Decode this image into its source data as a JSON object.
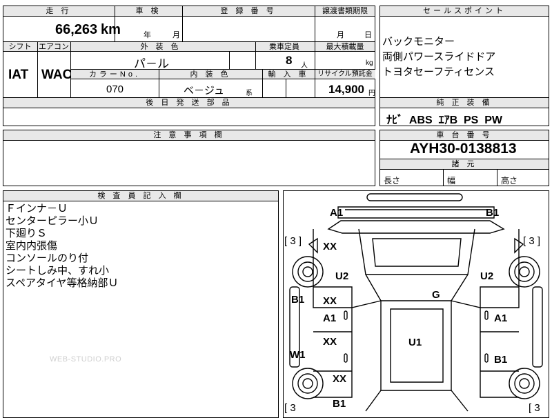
{
  "vehicle": {
    "mileage_label": "走 行",
    "mileage_value": "66,263",
    "mileage_unit": "km",
    "inspection_label": "車 検",
    "inspection_year": "年",
    "inspection_month": "月",
    "registration_label": "登 録 番 号",
    "transfer_label": "譲渡書類期限",
    "transfer_month": "月",
    "transfer_day": "日",
    "shift_label": "シフト",
    "shift_value": "IAT",
    "ac_label": "エアコン",
    "ac_value": "WAC",
    "exterior_color_label": "外 装 色",
    "exterior_color_value": "パ－ル",
    "capacity_label": "乗車定員",
    "capacity_value": "8",
    "capacity_unit": "人",
    "max_load_label": "最大積載量",
    "max_load_unit": "kg",
    "color_no_label": "カラーNo.",
    "color_no_value": "070",
    "interior_color_label": "内 装 色",
    "interior_color_value": "ベ－ジュ",
    "interior_color_suffix": "系",
    "import_label": "輸 入 車",
    "recycle_label": "リサイクル預託金",
    "recycle_value": "14,900",
    "recycle_unit": "円",
    "delivery_parts_label": "後 日 発 送 部 品"
  },
  "selling_points": {
    "label": "セールスポイント",
    "items": [
      "バックモニター",
      "両側パワースライドドア",
      "トヨタセーフティセンス"
    ],
    "genuine_label": "純 正 装 備",
    "genuine_value": "ﾅﾋﾞ  ABS  ｴｱB  PS  PW"
  },
  "caution": {
    "label": "注 意 事 項 欄"
  },
  "chassis": {
    "label": "車 台 番 号",
    "value": "AYH30-0138813",
    "dims_label": "諸 元",
    "length_label": "長さ",
    "width_label": "幅",
    "height_label": "高さ"
  },
  "inspector": {
    "label": "検 査 員 記 入 欄",
    "notes": [
      "Ｆインナ－Ｕ",
      "センターピラー小Ｕ",
      "下廻りＳ",
      "室内内張傷",
      "コンソールのり付",
      "シートしみ中、すれ小",
      "スペアタイヤ等格納部Ｕ"
    ]
  },
  "watermark": "WEB-STUDIO.PRO",
  "damage_map": {
    "marks": [
      "A1",
      "B1",
      "XX",
      "U2",
      "U2",
      "B1",
      "XX",
      "G",
      "A1",
      "A1",
      "W1",
      "XX",
      "U1",
      "B1",
      "XX",
      "B1"
    ],
    "brackets": [
      "[ 3 ]",
      "[ 3 ]",
      "[ 3",
      "[ 3"
    ]
  }
}
